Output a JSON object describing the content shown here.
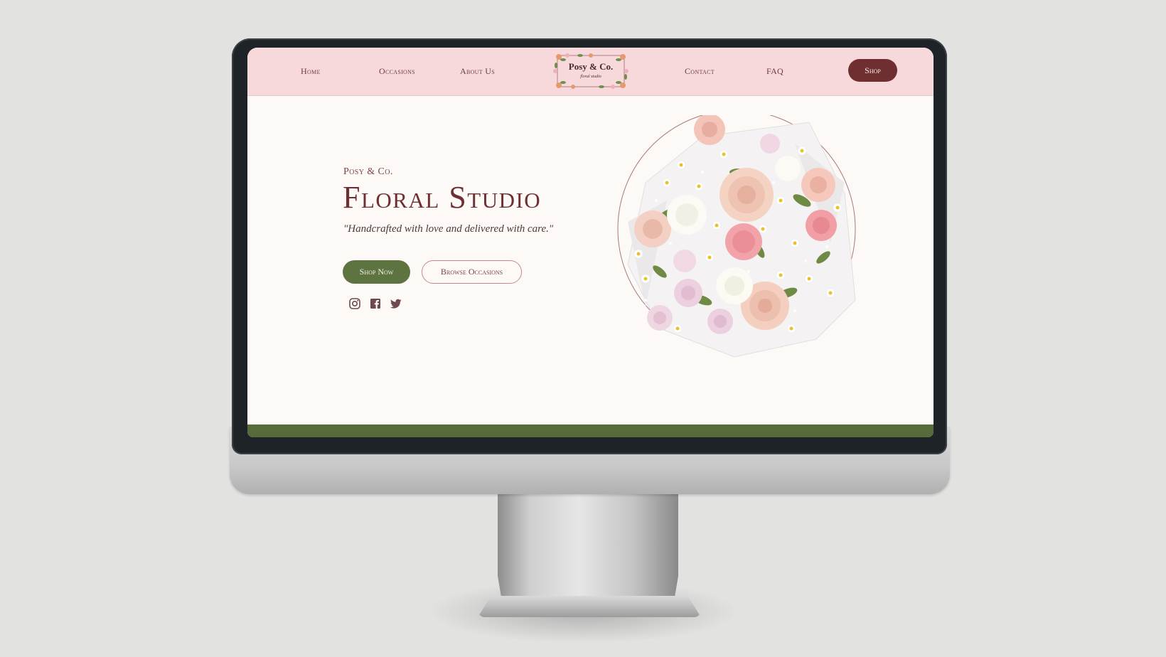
{
  "nav": {
    "links": [
      {
        "label": "Home"
      },
      {
        "label": "Occasions"
      },
      {
        "label": "About Us"
      },
      {
        "label": "Contact"
      },
      {
        "label": "FAQ"
      }
    ],
    "logo": {
      "name": "Posy & Co.",
      "sub": "floral studio"
    },
    "shop_label": "Shop"
  },
  "hero": {
    "brand": "Posy & Co.",
    "title": "Floral Studio",
    "tagline": "\"Handcrafted with love and delivered with care.\"",
    "primary_button": "Shop Now",
    "secondary_button": "Browse Occasions",
    "social_icons": [
      "instagram-icon",
      "facebook-icon",
      "twitter-icon"
    ]
  },
  "colors": {
    "nav_bg": "#f7d9dc",
    "accent_maroon": "#6f2f31",
    "accent_green": "#5d7441",
    "page_bg": "#fdf9f6"
  }
}
